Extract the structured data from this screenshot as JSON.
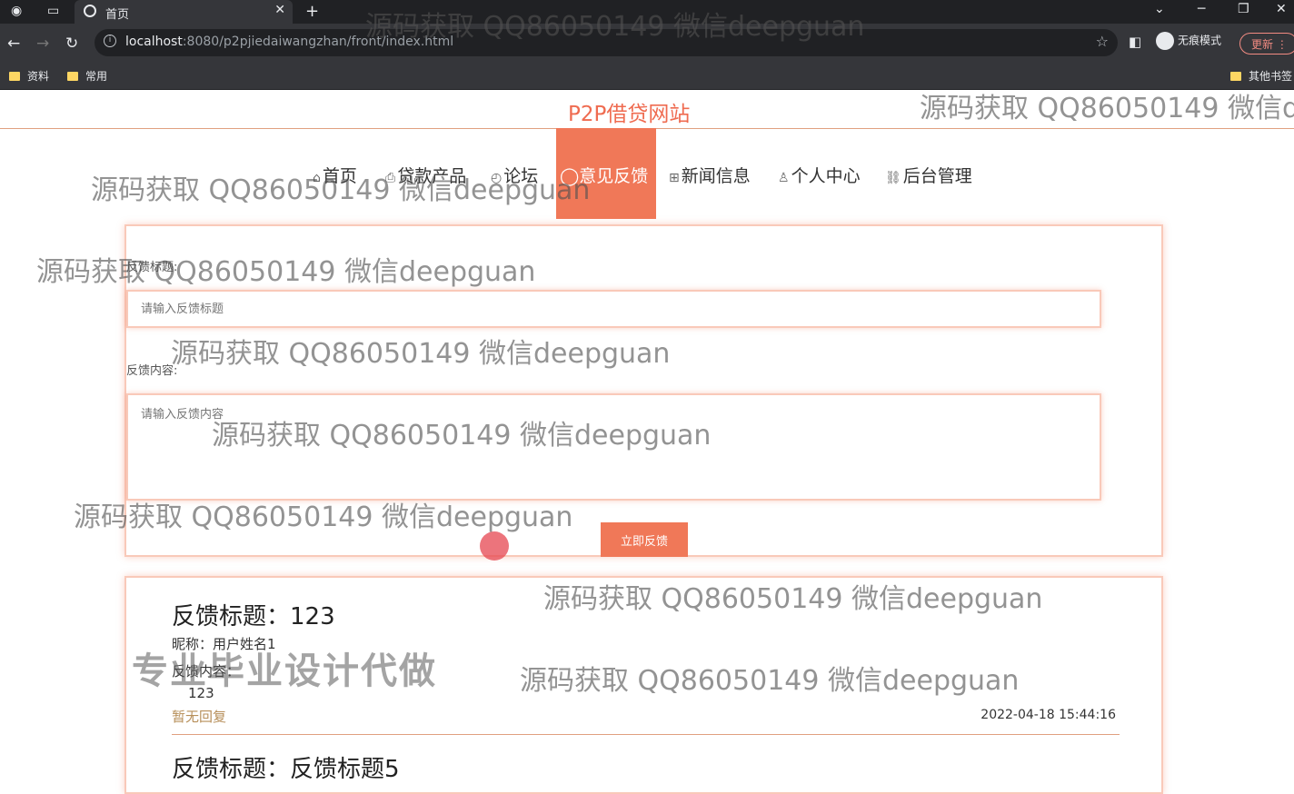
{
  "browser": {
    "tab_title": "首页",
    "tab_close": "✕",
    "new_tab": "+",
    "url_host": "localhost",
    "url_rest": ":8080/p2pjiedaiwangzhan/front/index.html",
    "incognito_label": "无痕模式",
    "update_label": "更新",
    "bookmarks": [
      {
        "label": "资料"
      },
      {
        "label": "常用"
      },
      {
        "label": "其他书签"
      }
    ]
  },
  "site": {
    "title": "P2P借贷网站",
    "nav": [
      {
        "icon": "⌂",
        "label": "首页"
      },
      {
        "icon": "⎙",
        "label": "贷款产品"
      },
      {
        "icon": "◴",
        "label": "论坛"
      },
      {
        "icon": "◯",
        "label": "意见反馈",
        "active": true
      },
      {
        "icon": "⊞",
        "label": "新闻信息"
      },
      {
        "icon": "♙",
        "label": "个人中心"
      },
      {
        "icon": "⛓",
        "label": "后台管理"
      }
    ],
    "form": {
      "title_label": "反馈标题:",
      "title_placeholder": "请输入反馈标题",
      "content_label": "反馈内容:",
      "content_placeholder": "请输入反馈内容",
      "submit": "立即反馈"
    },
    "feedback": [
      {
        "title": "反馈标题：123",
        "nickname": "昵称：用户姓名1",
        "content_label": "反馈内容：",
        "content": "123",
        "reply": "暂无回复",
        "time": "2022-04-18 15:44:16"
      },
      {
        "title": "反馈标题：反馈标题5"
      }
    ]
  },
  "watermarks": {
    "text": "源码获取 QQ86050149 微信deepguan",
    "text_cut": "源码获取 QQ86050149 微信de",
    "stamp": "专业毕业设计代做"
  },
  "colors": {
    "accent": "#f07858",
    "title": "#ef6b50",
    "reply": "#b78f5a"
  }
}
